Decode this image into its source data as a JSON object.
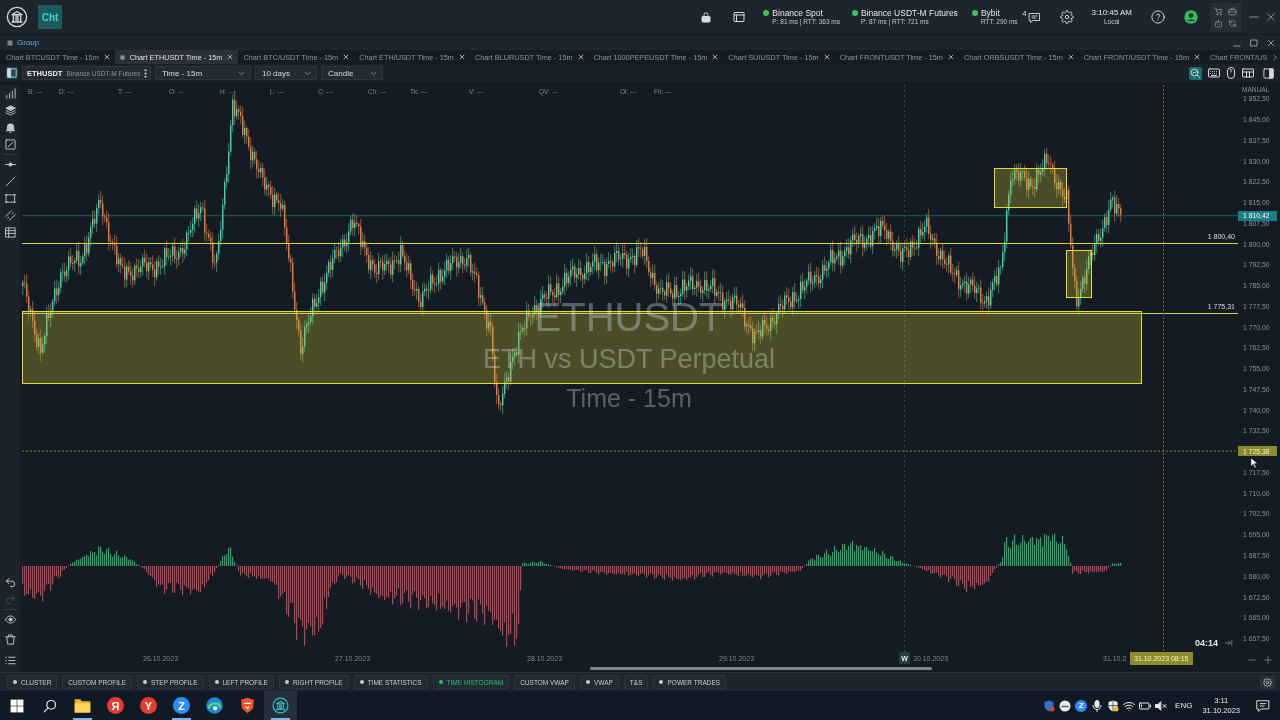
{
  "app_bar": {
    "workspace": "Cht",
    "connections": [
      {
        "name": "Binance Spot",
        "stats": "P: 81 ms | RTT: 363 ms",
        "color": "#3ec35c"
      },
      {
        "name": "Binance USDT-M Futures",
        "stats": "P: 87 ms | RTT: 721 ms",
        "color": "#3ec35c"
      },
      {
        "name": "Bybit",
        "stats": "RTT: 290 ms",
        "color": "#3ec35c"
      }
    ],
    "messages_count": "4",
    "clock": {
      "time": "3:10:45 AM",
      "zone": "Local"
    }
  },
  "group": {
    "title": "Group"
  },
  "tabs": [
    {
      "label": "Chart BTCUSDT Time - 15m",
      "selected": false,
      "close_button": true
    },
    {
      "label": "Chart ETHUSDT Time - 15m",
      "selected": true,
      "close_button": true
    },
    {
      "label": "Chart BTC/USDT Time - 15m",
      "selected": false,
      "close_button": true
    },
    {
      "label": "Chart ETH/USDT Time - 15m",
      "selected": false,
      "close_button": true
    },
    {
      "label": "Chart BLURUSDT Time - 15m",
      "selected": false,
      "close_button": true
    },
    {
      "label": "Chart 1000PEPEUSDT Time - 15m",
      "selected": false,
      "close_button": true
    },
    {
      "label": "Chart SUIUSDT Time - 15m",
      "selected": false,
      "close_button": true
    },
    {
      "label": "Chart FRONTUSDT Time - 15m",
      "selected": false,
      "close_button": true
    },
    {
      "label": "Chart ORBSUSDT Time - 15m",
      "selected": false,
      "close_button": true
    },
    {
      "label": "Chart FRONT/USDT Time - 15m",
      "selected": false,
      "close_button": true
    },
    {
      "label": "Chart FRONT/US",
      "selected": false,
      "close_button": false
    }
  ],
  "toolbar": {
    "symbol": "ETHUSDT",
    "exchange": "Binance USDT-M Futures",
    "timeframe": "Time - 15m",
    "period": "10 days",
    "chart_type": "Candle"
  },
  "drawing_tools": {
    "undo_disabled": false,
    "redo_disabled": true
  },
  "chart": {
    "info": [
      "B: ---",
      "D: ---",
      "T: ---",
      "O: ---",
      "H: ---",
      "L: ---",
      "C: ---",
      "Ch: ---",
      "Tk: ---",
      "V: ---",
      "QV: ---",
      "Oi: ---",
      "Fn: ---"
    ],
    "watermark": {
      "symbol": "ETHUSDT",
      "description": "ETH vs USDT Perpetual",
      "timeframe": "Time - 15m"
    },
    "scale_mode": "MANUAL",
    "price_labels": [
      "1 852,50",
      "1 845,00",
      "1 837,50",
      "1 830,00",
      "1 822,50",
      "1 815,00",
      "1 807,50",
      "1 800,00",
      "1 792,50",
      "1 785,00",
      "1 777,50",
      "1 770,00",
      "1 762,50",
      "1 755,00",
      "1 747,50",
      "1 740,00",
      "1 732,50",
      "1 717,50",
      "1 710,00",
      "1 702,50",
      "1 695,00",
      "1 687,50",
      "1 680,00",
      "1 672,50",
      "1 665,00",
      "1 657,50"
    ],
    "levels": [
      {
        "price_label": "1 800,40"
      },
      {
        "price_label": "1 775,31"
      }
    ],
    "last_price": "1 810,42",
    "cursor_price": "1 725,38",
    "cursor_time": "31.10.2023 08:15",
    "countdown": "04:14",
    "time_labels": [
      {
        "date": "26.10.2023"
      },
      {
        "date": "27.10.2023"
      },
      {
        "date": "28.10.2023"
      },
      {
        "date": "29.10.2023"
      },
      {
        "date": "30.10.2023",
        "week_marker": "W"
      },
      {
        "date": "31.10.2"
      }
    ]
  },
  "modules": [
    {
      "label": "CLUSTER",
      "dot": true,
      "on": false
    },
    {
      "label": "CUSTOM PROFILE",
      "dot": false,
      "on": false
    },
    {
      "label": "STEP PROFILE",
      "dot": true,
      "on": false
    },
    {
      "label": "LEFT PROFILE",
      "dot": true,
      "on": false
    },
    {
      "label": "RIGHT PROFILE",
      "dot": true,
      "on": false
    },
    {
      "label": "TIME STATISTICS",
      "dot": true,
      "on": false
    },
    {
      "label": "TIME HISTOGRAM",
      "dot": true,
      "on": true
    },
    {
      "label": "CUSTOM VWAP",
      "dot": false,
      "on": false
    },
    {
      "label": "VWAP",
      "dot": true,
      "on": false
    },
    {
      "label": "T&S",
      "dot": false,
      "on": false
    },
    {
      "label": "POWER TRADES",
      "dot": true,
      "on": false
    }
  ],
  "taskbar": {
    "apps": [
      {
        "kind": "folder",
        "running": true,
        "selected": false
      },
      {
        "kind": "letter",
        "glyph": "Я",
        "color": "#e53a2f",
        "running": false,
        "selected": false
      },
      {
        "kind": "letter",
        "glyph": "Y",
        "color": "#e53a2f",
        "running": false,
        "selected": false
      },
      {
        "kind": "letter",
        "glyph": "Z",
        "color": "#2d8cff",
        "running": true,
        "selected": false
      },
      {
        "kind": "wave",
        "running": false,
        "selected": false
      },
      {
        "kind": "lion",
        "running": false,
        "selected": false
      },
      {
        "kind": "logo",
        "running": true,
        "selected": true
      }
    ],
    "tray": {
      "zoom_glyph": "Z",
      "language": "ENG",
      "time": "3:11",
      "date": "31.10.2023"
    }
  }
}
